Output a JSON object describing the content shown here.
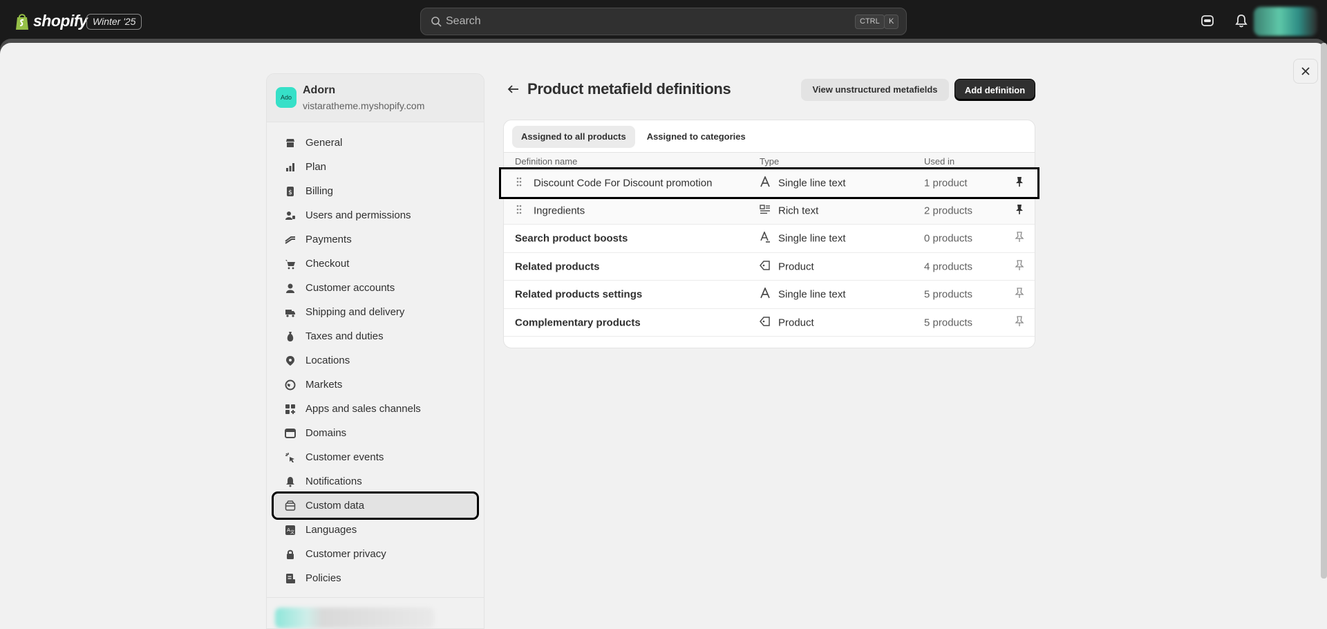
{
  "topbar": {
    "brand": "shopify",
    "edition": "Winter '25",
    "search_placeholder": "Search",
    "kbd_ctrl": "CTRL",
    "kbd_k": "K"
  },
  "store": {
    "badge": "Ado",
    "name": "Adorn",
    "url": "vistaratheme.myshopify.com"
  },
  "sidebar": {
    "items": [
      {
        "label": "General",
        "icon": "store-icon"
      },
      {
        "label": "Plan",
        "icon": "plan-icon"
      },
      {
        "label": "Billing",
        "icon": "billing-icon"
      },
      {
        "label": "Users and permissions",
        "icon": "users-icon"
      },
      {
        "label": "Payments",
        "icon": "payments-icon"
      },
      {
        "label": "Checkout",
        "icon": "cart-icon"
      },
      {
        "label": "Customer accounts",
        "icon": "person-icon"
      },
      {
        "label": "Shipping and delivery",
        "icon": "truck-icon"
      },
      {
        "label": "Taxes and duties",
        "icon": "tax-icon"
      },
      {
        "label": "Locations",
        "icon": "location-icon"
      },
      {
        "label": "Markets",
        "icon": "globe-icon"
      },
      {
        "label": "Apps and sales channels",
        "icon": "apps-icon"
      },
      {
        "label": "Domains",
        "icon": "domain-icon"
      },
      {
        "label": "Customer events",
        "icon": "cursor-icon"
      },
      {
        "label": "Notifications",
        "icon": "bell-icon"
      },
      {
        "label": "Custom data",
        "icon": "database-icon"
      },
      {
        "label": "Languages",
        "icon": "language-icon"
      },
      {
        "label": "Customer privacy",
        "icon": "lock-icon"
      },
      {
        "label": "Policies",
        "icon": "policy-icon"
      }
    ],
    "active_index": 15
  },
  "main": {
    "title": "Product metafield definitions",
    "btn_unstructured": "View unstructured metafields",
    "btn_add": "Add definition",
    "tabs": [
      "Assigned to all products",
      "Assigned to categories"
    ],
    "columns": {
      "name": "Definition name",
      "type": "Type",
      "used": "Used in"
    },
    "rows": [
      {
        "name": "Discount Code For Discount promotion",
        "type": "Single line text",
        "type_icon": "text-icon",
        "used": "1 product",
        "pinned": true
      },
      {
        "name": "Ingredients",
        "type": "Rich text",
        "type_icon": "rich-text-icon",
        "used": "2 products",
        "pinned": true
      },
      {
        "name": "Search product boosts",
        "type": "Single line text",
        "type_icon": "text-list-icon",
        "used": "0 products",
        "pinned": false
      },
      {
        "name": "Related products",
        "type": "Product",
        "type_icon": "product-tag-icon",
        "used": "4 products",
        "pinned": false
      },
      {
        "name": "Related products settings",
        "type": "Single line text",
        "type_icon": "text-icon",
        "used": "5 products",
        "pinned": false
      },
      {
        "name": "Complementary products",
        "type": "Product",
        "type_icon": "product-tag-icon",
        "used": "5 products",
        "pinned": false
      }
    ]
  }
}
